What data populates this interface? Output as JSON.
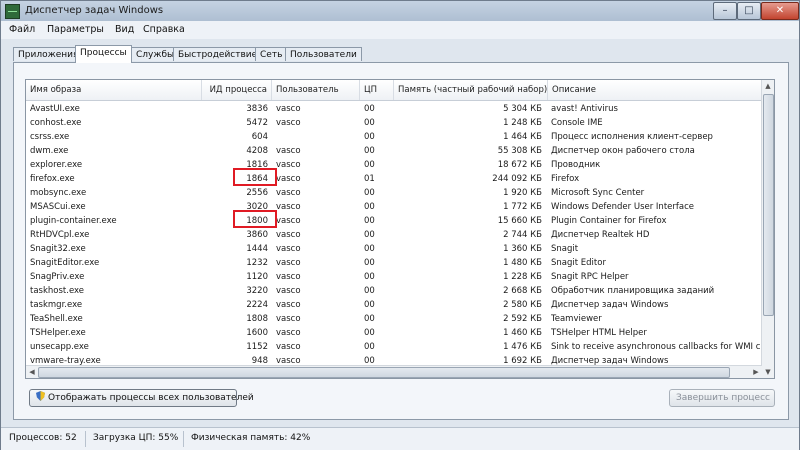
{
  "window": {
    "title": "Диспетчер задач Windows",
    "controls": {
      "minimize": "–",
      "maximize": "□",
      "close": "✕"
    }
  },
  "menu": [
    "Файл",
    "Параметры",
    "Вид",
    "Справка"
  ],
  "tabs": [
    "Приложения",
    "Процессы",
    "Службы",
    "Быстродействие",
    "Сеть",
    "Пользователи"
  ],
  "active_tab": "Процессы",
  "columns": [
    "Имя образа",
    "ИД процесса",
    "Пользователь",
    "ЦП",
    "Память (частный рабочий набор)",
    "Описание"
  ],
  "rows": [
    {
      "name": "AvastUI.exe",
      "pid": "3836",
      "user": "vasco",
      "cpu": "00",
      "mem": "5 304 КБ",
      "desc": "avast! Antivirus"
    },
    {
      "name": "conhost.exe",
      "pid": "5472",
      "user": "vasco",
      "cpu": "00",
      "mem": "1 248 КБ",
      "desc": "Console IME"
    },
    {
      "name": "csrss.exe",
      "pid": "604",
      "user": "",
      "cpu": "00",
      "mem": "1 464 КБ",
      "desc": "Процесс исполнения клиент-сервер"
    },
    {
      "name": "dwm.exe",
      "pid": "4208",
      "user": "vasco",
      "cpu": "00",
      "mem": "55 308 КБ",
      "desc": "Диспетчер окон рабочего стола"
    },
    {
      "name": "explorer.exe",
      "pid": "1816",
      "user": "vasco",
      "cpu": "00",
      "mem": "18 672 КБ",
      "desc": "Проводник"
    },
    {
      "name": "firefox.exe",
      "pid": "1864",
      "user": "vasco",
      "cpu": "01",
      "mem": "244 092 КБ",
      "desc": "Firefox"
    },
    {
      "name": "mobsync.exe",
      "pid": "2556",
      "user": "vasco",
      "cpu": "00",
      "mem": "1 920 КБ",
      "desc": "Microsoft Sync Center"
    },
    {
      "name": "MSASCui.exe",
      "pid": "3020",
      "user": "vasco",
      "cpu": "00",
      "mem": "1 772 КБ",
      "desc": "Windows Defender User Interface"
    },
    {
      "name": "plugin-container.exe",
      "pid": "1800",
      "user": "vasco",
      "cpu": "00",
      "mem": "15 660 КБ",
      "desc": "Plugin Container for Firefox"
    },
    {
      "name": "RtHDVCpl.exe",
      "pid": "3860",
      "user": "vasco",
      "cpu": "00",
      "mem": "2 744 КБ",
      "desc": "Диспетчер Realtek HD"
    },
    {
      "name": "Snagit32.exe",
      "pid": "1444",
      "user": "vasco",
      "cpu": "00",
      "mem": "1 360 КБ",
      "desc": "Snagit"
    },
    {
      "name": "SnagitEditor.exe",
      "pid": "1232",
      "user": "vasco",
      "cpu": "00",
      "mem": "1 480 КБ",
      "desc": "Snagit Editor"
    },
    {
      "name": "SnagPriv.exe",
      "pid": "1120",
      "user": "vasco",
      "cpu": "00",
      "mem": "1 228 КБ",
      "desc": "Snagit RPC Helper"
    },
    {
      "name": "taskhost.exe",
      "pid": "3220",
      "user": "vasco",
      "cpu": "00",
      "mem": "2 668 КБ",
      "desc": "Обработчик планировщика заданий"
    },
    {
      "name": "taskmgr.exe",
      "pid": "2224",
      "user": "vasco",
      "cpu": "00",
      "mem": "2 580 КБ",
      "desc": "Диспетчер задач Windows"
    },
    {
      "name": "TeaShell.exe",
      "pid": "1808",
      "user": "vasco",
      "cpu": "00",
      "mem": "2 592 КБ",
      "desc": "Teamviewer"
    },
    {
      "name": "TSHelper.exe",
      "pid": "1600",
      "user": "vasco",
      "cpu": "00",
      "mem": "1 460 КБ",
      "desc": "TSHelper HTML Helper"
    },
    {
      "name": "unsecapp.exe",
      "pid": "1152",
      "user": "vasco",
      "cpu": "00",
      "mem": "1 476 КБ",
      "desc": "Sink to receive asynchronous callbacks for WMI cl"
    },
    {
      "name": "vmware-tray.exe",
      "pid": "948",
      "user": "vasco",
      "cpu": "00",
      "mem": "1 692 КБ",
      "desc": "Диспетчер задач Windows"
    }
  ],
  "show_all_button": "Отображать процессы всех пользователей",
  "end_process_button": "Завершить процесс",
  "status": {
    "processes": "Процессов: 52",
    "cpu": "Загрузка ЦП: 55%",
    "memory": "Физическая память: 42%"
  },
  "colors": {
    "highlight": "#e01b24"
  }
}
